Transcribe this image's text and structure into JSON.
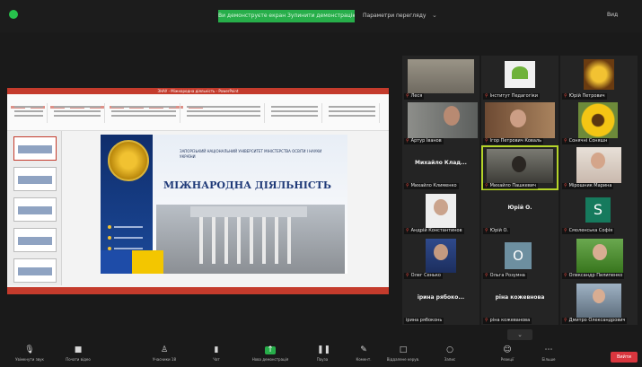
{
  "topbar": {
    "share_banner": "Ви демонструєте екран   Зупинити демонстрацію",
    "view_options": "Параметри перегляду",
    "view_button": "Вид"
  },
  "presentation": {
    "window_title": "ЗНАУ - Міжнародна діяльність - PowerPoint",
    "heading": "МІЖНАРОДНА ДІЯЛЬНІСТЬ",
    "university_name": "ЗАПОРІЗЬКИЙ НАЦІОНАЛЬНИЙ УНІВЕРСИТЕТ МІНІСТЕРСТВА ОСВІТИ І НАУКИ УКРАЇНИ"
  },
  "participants": [
    {
      "name": "Леся"
    },
    {
      "name": "Інститут Педагогіки"
    },
    {
      "name": "Юрій Петрович"
    },
    {
      "name": "Артур Іванов"
    },
    {
      "name": "Ігор Петрович Коваль"
    },
    {
      "name": "Сонячні Соняшн"
    },
    {
      "name": "Михайло Клименко",
      "big": "Михайло Клад..."
    },
    {
      "name": "Михайло Пашкевич"
    },
    {
      "name": "Мірошник Марина"
    },
    {
      "name": "Андрій Константинов"
    },
    {
      "name": "Юрій О.",
      "big": "Юрій О."
    },
    {
      "name": "Смоленська Софія"
    },
    {
      "name": "Олег Сенько"
    },
    {
      "name": "Ольга Розумна"
    },
    {
      "name": "Олександр Пилипенко"
    },
    {
      "name": "ірина рябоконь",
      "big": "ірина рябоко..."
    },
    {
      "name": "ріна кожеванова",
      "big": "ріна кожевнова"
    },
    {
      "name": "Дмитро Олександрович"
    }
  ],
  "toolbar": {
    "items": [
      {
        "label": "Увімкнути звук",
        "icon": "microphone-icon"
      },
      {
        "label": "Почати відео",
        "icon": "video-camera-icon"
      },
      {
        "label": "Учасники 18",
        "icon": "participants-icon"
      },
      {
        "label": "Чат",
        "icon": "chat-icon"
      },
      {
        "label": "Нова демонстрація",
        "icon": "share-screen-icon"
      },
      {
        "label": "Пауза",
        "icon": "pause-icon"
      },
      {
        "label": "Комент.",
        "icon": "annotate-icon"
      },
      {
        "label": "Віддалене керув.",
        "icon": "remote-control-icon"
      },
      {
        "label": "Запис",
        "icon": "record-icon"
      },
      {
        "label": "Реакції",
        "icon": "reaction-icon"
      },
      {
        "label": "Більше",
        "icon": "more-icon"
      }
    ],
    "end_label": "Вийти"
  },
  "colors": {
    "share_green": "#27ae4a",
    "end_red": "#d9363e",
    "active_speaker": "#b5d42a"
  }
}
